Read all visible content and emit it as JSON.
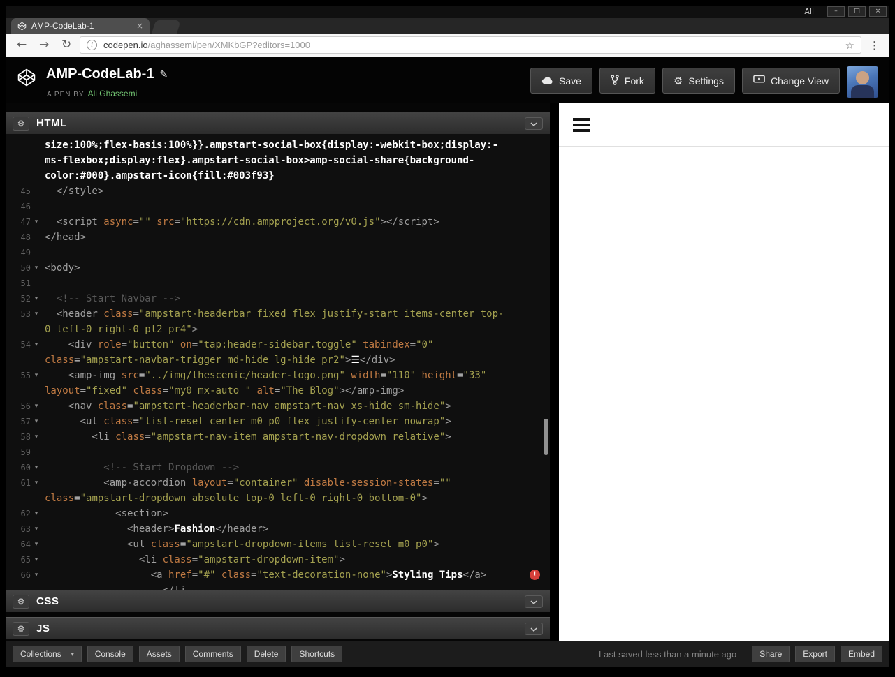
{
  "wm": {
    "title": "All",
    "minimize": "–",
    "maximize": "□",
    "close": "×"
  },
  "browser": {
    "tab_title": "AMP-CodeLab-1",
    "url_host": "codepen.io",
    "url_rest": "/aghassemi/pen/XMKbGP?editors=1000"
  },
  "icons": {
    "back": "←",
    "forward": "→",
    "reload": "↻",
    "page_info": "i",
    "bookmark_star": "☆",
    "menu_dots": "⋮",
    "tab_close": "×",
    "edit_pencil": "✎",
    "gear": "⚙",
    "caret_down": "▾",
    "error_mark": "!"
  },
  "header": {
    "pen_title": "AMP-CodeLab-1",
    "byline_prefix": "A PEN BY",
    "author": "Ali Ghassemi",
    "save": "Save",
    "fork": "Fork",
    "settings": "Settings",
    "change_view": "Change View"
  },
  "panels": {
    "html": "HTML",
    "css": "CSS",
    "js": "JS"
  },
  "colors": {
    "author_green": "#71c171",
    "error_red": "#d43f3a",
    "attr_orange": "#c07a43",
    "string_olive": "#a3a04f"
  },
  "code": {
    "rows": [
      {
        "num": "",
        "fold": false,
        "tokens": [
          [
            "w",
            "size:100%;flex-basis:100%}}.ampstart-social-box{display:-webkit-box;display:-"
          ]
        ]
      },
      {
        "num": "",
        "fold": false,
        "tokens": [
          [
            "w",
            "ms-flexbox;display:flex}.ampstart-social-box>amp-social-share{background-"
          ]
        ]
      },
      {
        "num": "",
        "fold": false,
        "tokens": [
          [
            "w",
            "color:#000}.ampstart-icon{fill:#003f93}"
          ]
        ]
      },
      {
        "num": "45",
        "fold": false,
        "tokens": [
          [
            "t",
            "  </style>"
          ]
        ]
      },
      {
        "num": "46",
        "fold": false,
        "tokens": []
      },
      {
        "num": "47",
        "fold": true,
        "tokens": [
          [
            "t",
            "  <script "
          ],
          [
            "a",
            "async"
          ],
          [
            "p",
            "="
          ],
          [
            "s",
            "\"\""
          ],
          [
            "p",
            " "
          ],
          [
            "a",
            "src"
          ],
          [
            "p",
            "="
          ],
          [
            "s",
            "\"https://cdn.ampproject.org/v0.js\""
          ],
          [
            "t",
            "></script>"
          ]
        ]
      },
      {
        "num": "48",
        "fold": false,
        "tokens": [
          [
            "t",
            "</head>"
          ]
        ]
      },
      {
        "num": "49",
        "fold": false,
        "tokens": []
      },
      {
        "num": "50",
        "fold": true,
        "tokens": [
          [
            "t",
            "<body>"
          ]
        ]
      },
      {
        "num": "51",
        "fold": false,
        "tokens": []
      },
      {
        "num": "52",
        "fold": true,
        "tokens": [
          [
            "c",
            "  <!-- Start Navbar -->"
          ]
        ]
      },
      {
        "num": "53",
        "fold": true,
        "tokens": [
          [
            "t",
            "  <header "
          ],
          [
            "a",
            "class"
          ],
          [
            "p",
            "="
          ],
          [
            "s",
            "\"ampstart-headerbar fixed flex justify-start items-center top-"
          ]
        ]
      },
      {
        "num": "",
        "fold": false,
        "tokens": [
          [
            "s",
            "0 left-0 right-0 pl2 pr4\""
          ],
          [
            "t",
            ">"
          ]
        ]
      },
      {
        "num": "54",
        "fold": true,
        "tokens": [
          [
            "t",
            "    <div "
          ],
          [
            "a",
            "role"
          ],
          [
            "p",
            "="
          ],
          [
            "s",
            "\"button\""
          ],
          [
            "p",
            " "
          ],
          [
            "a",
            "on"
          ],
          [
            "p",
            "="
          ],
          [
            "s",
            "\"tap:header-sidebar.toggle\""
          ],
          [
            "p",
            " "
          ],
          [
            "a",
            "tabindex"
          ],
          [
            "p",
            "="
          ],
          [
            "s",
            "\"0\""
          ]
        ]
      },
      {
        "num": "",
        "fold": false,
        "tokens": [
          [
            "a",
            "class"
          ],
          [
            "p",
            "="
          ],
          [
            "s",
            "\"ampstart-navbar-trigger md-hide lg-hide pr2\""
          ],
          [
            "t",
            ">"
          ],
          [
            "w",
            "☰"
          ],
          [
            "t",
            "</div>"
          ]
        ]
      },
      {
        "num": "55",
        "fold": true,
        "tokens": [
          [
            "t",
            "    <amp-img "
          ],
          [
            "a",
            "src"
          ],
          [
            "p",
            "="
          ],
          [
            "s",
            "\"../img/thescenic/header-logo.png\""
          ],
          [
            "p",
            " "
          ],
          [
            "a",
            "width"
          ],
          [
            "p",
            "="
          ],
          [
            "s",
            "\"110\""
          ],
          [
            "p",
            " "
          ],
          [
            "a",
            "height"
          ],
          [
            "p",
            "="
          ],
          [
            "s",
            "\"33\""
          ]
        ]
      },
      {
        "num": "",
        "fold": false,
        "tokens": [
          [
            "a",
            "layout"
          ],
          [
            "p",
            "="
          ],
          [
            "s",
            "\"fixed\""
          ],
          [
            "p",
            " "
          ],
          [
            "a",
            "class"
          ],
          [
            "p",
            "="
          ],
          [
            "s",
            "\"my0 mx-auto \""
          ],
          [
            "p",
            " "
          ],
          [
            "a",
            "alt"
          ],
          [
            "p",
            "="
          ],
          [
            "s",
            "\"The Blog\""
          ],
          [
            "t",
            "></amp-img>"
          ]
        ]
      },
      {
        "num": "56",
        "fold": true,
        "tokens": [
          [
            "t",
            "    <nav "
          ],
          [
            "a",
            "class"
          ],
          [
            "p",
            "="
          ],
          [
            "s",
            "\"ampstart-headerbar-nav ampstart-nav xs-hide sm-hide\""
          ],
          [
            "t",
            ">"
          ]
        ]
      },
      {
        "num": "57",
        "fold": true,
        "tokens": [
          [
            "t",
            "      <ul "
          ],
          [
            "a",
            "class"
          ],
          [
            "p",
            "="
          ],
          [
            "s",
            "\"list-reset center m0 p0 flex justify-center nowrap\""
          ],
          [
            "t",
            ">"
          ]
        ]
      },
      {
        "num": "58",
        "fold": true,
        "tokens": [
          [
            "t",
            "        <li "
          ],
          [
            "a",
            "class"
          ],
          [
            "p",
            "="
          ],
          [
            "s",
            "\"ampstart-nav-item ampstart-nav-dropdown relative\""
          ],
          [
            "t",
            ">"
          ]
        ]
      },
      {
        "num": "59",
        "fold": false,
        "tokens": []
      },
      {
        "num": "60",
        "fold": true,
        "tokens": [
          [
            "c",
            "          <!-- Start Dropdown -->"
          ]
        ]
      },
      {
        "num": "61",
        "fold": true,
        "tokens": [
          [
            "t",
            "          <amp-accordion "
          ],
          [
            "a",
            "layout"
          ],
          [
            "p",
            "="
          ],
          [
            "s",
            "\"container\""
          ],
          [
            "p",
            " "
          ],
          [
            "a",
            "disable-session-states"
          ],
          [
            "p",
            "="
          ],
          [
            "s",
            "\"\""
          ]
        ]
      },
      {
        "num": "",
        "fold": false,
        "tokens": [
          [
            "a",
            "class"
          ],
          [
            "p",
            "="
          ],
          [
            "s",
            "\"ampstart-dropdown absolute top-0 left-0 right-0 bottom-0\""
          ],
          [
            "t",
            ">"
          ]
        ]
      },
      {
        "num": "62",
        "fold": true,
        "tokens": [
          [
            "t",
            "            <section>"
          ]
        ]
      },
      {
        "num": "63",
        "fold": true,
        "tokens": [
          [
            "t",
            "              <header>"
          ],
          [
            "w",
            "Fashion"
          ],
          [
            "t",
            "</header>"
          ]
        ]
      },
      {
        "num": "64",
        "fold": true,
        "tokens": [
          [
            "t",
            "              <ul "
          ],
          [
            "a",
            "class"
          ],
          [
            "p",
            "="
          ],
          [
            "s",
            "\"ampstart-dropdown-items list-reset m0 p0\""
          ],
          [
            "t",
            ">"
          ]
        ]
      },
      {
        "num": "65",
        "fold": true,
        "tokens": [
          [
            "t",
            "                <li "
          ],
          [
            "a",
            "class"
          ],
          [
            "p",
            "="
          ],
          [
            "s",
            "\"ampstart-dropdown-item\""
          ],
          [
            "t",
            ">"
          ]
        ]
      },
      {
        "num": "66",
        "fold": true,
        "error": true,
        "tokens": [
          [
            "t",
            "                  <a "
          ],
          [
            "a",
            "href"
          ],
          [
            "p",
            "="
          ],
          [
            "s",
            "\"#\""
          ],
          [
            "p",
            " "
          ],
          [
            "a",
            "class"
          ],
          [
            "p",
            "="
          ],
          [
            "s",
            "\"text-decoration-none\""
          ],
          [
            "t",
            ">"
          ],
          [
            "w",
            "Styling Tips"
          ],
          [
            "t",
            "</a>"
          ]
        ]
      },
      {
        "num": "",
        "fold": false,
        "tokens": [
          [
            "t",
            "                    </li"
          ]
        ]
      }
    ]
  },
  "footer": {
    "collections": "Collections",
    "console": "Console",
    "assets": "Assets",
    "comments": "Comments",
    "delete": "Delete",
    "shortcuts": "Shortcuts",
    "status": "Last saved less than a minute ago",
    "share": "Share",
    "export": "Export",
    "embed": "Embed"
  }
}
